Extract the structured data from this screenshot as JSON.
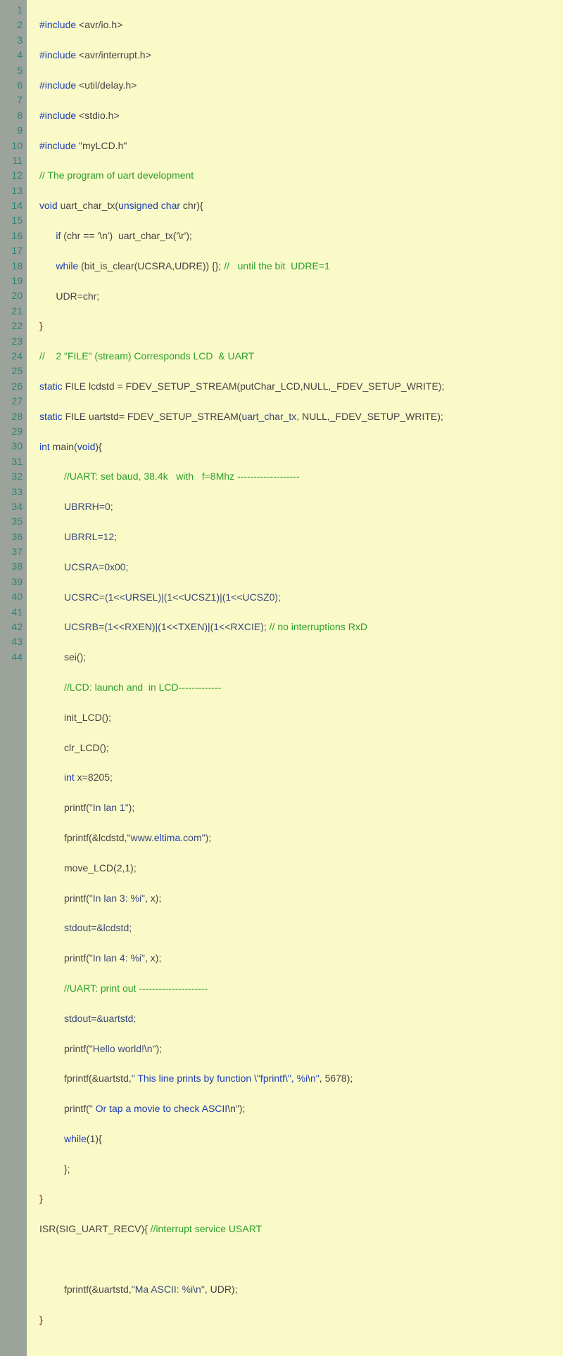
{
  "lineCount": 44,
  "lines": {
    "l1_a": "#include",
    "l1_b": " <avr/io.h>",
    "l2_a": "#include",
    "l2_b": " <avr/interrupt.h>",
    "l3_a": "#include",
    "l3_b": " <util/delay.h>",
    "l4_a": "#include",
    "l4_b": " <stdio.h>",
    "l5_a": "#include",
    "l5_b": " \"myLCD.h\"",
    "l6": "// The program of uart development",
    "l7_a": "void",
    "l7_b": " uart_char_tx(",
    "l7_c": "unsigned char",
    "l7_d": " chr){",
    "l8_a": "      if",
    "l8_b": " (chr == ",
    "l8_c": "'\\n'",
    "l8_d": ")  uart_char_tx(",
    "l8_e": "'\\r'",
    "l8_f": ");",
    "l9_a": "      while",
    "l9_b": " (bit_is_clear(UCSRA,UDRE)) {}; ",
    "l9_c": "//   until the bit  UDRE=1",
    "l10": "      UDR=chr;",
    "l11": "}",
    "l12_a": "//    2 \"FILE\" (stream)",
    "l12_b": " Corresponds LCD  & UART",
    "l13_a": "static",
    "l13_b": " FILE lcdstd = FDEV_SETUP_STREAM(putChar_LCD,NULL,_FDEV_SETUP_WRITE);",
    "l14_a": "static",
    "l14_b": " FILE uartstd= FDEV_SETUP_STREAM(",
    "l14_c": "uart_char_tx",
    "l14_d": ", NULL,_FDEV_SETUP_WRITE);",
    "l15_a": "int",
    "l15_b": " main(",
    "l15_c": "void",
    "l15_d": "){",
    "l16": "         //UART: set baud, 38.4k   with   f=8Mhz -------------------",
    "l17": "         UBRRH=0;",
    "l18": "         UBRRL=12;",
    "l19": "         UCSRA=0x00;",
    "l20": "         UCSRC=(1<<URSEL)|(1<<UCSZ1)|(1<<UCSZ0);",
    "l21_a": "         UCSRB=(1<<RXEN)|(1<<TXEN)|(1<<RXCIE); ",
    "l21_b": "// no interruptions RxD",
    "l22": "         sei();",
    "l23": "         //LCD: launch and  in LCD-------------",
    "l24": "         init_LCD();",
    "l25": "         clr_LCD();",
    "l26_a": "         int",
    "l26_b": " x=8205;",
    "l27_a": "         printf(",
    "l27_b": "\"In lan 1\"",
    "l27_c": ");",
    "l28_a": "         fprintf(&lcdstd,",
    "l28_b": "\"www.",
    "l28_c": "eltima",
    "l28_d": ".com\"",
    "l28_e": ");",
    "l29": "         move_LCD(2,1);",
    "l30_a": "         printf(",
    "l30_b": "\"In lan 3: %i\"",
    "l30_c": ", x);",
    "l31": "         stdout=&lcdstd;",
    "l32_a": "         printf(",
    "l32_b": "\"In lan 4: %i\"",
    "l32_c": ", x);",
    "l33": "         //UART: print out ---------------------",
    "l34": "         stdout=&uartstd;",
    "l35_a": "         printf(",
    "l35_b": "\"Hello world!\\n\"",
    "l35_c": ");",
    "l36_a": "         fprintf(&uartstd,",
    "l36_b": "\" This line prints by function \\\"fprintf\\\", %i\\n\"",
    "l36_c": ", 5678);",
    "l37_a": "         printf(",
    "l37_b": "\" Or tap a movie to check ASCII",
    "l37_c": "\\n\"",
    "l37_d": ");",
    "l38_a": "         while",
    "l38_b": "(1){",
    "l39": "         };",
    "l40": "}",
    "l41_a": "ISR(SIG_UART_RECV){ ",
    "l41_b": "//interrupt service USART",
    "l42": "",
    "l43_a": "         fprintf(&uartstd,",
    "l43_b": "\"Ma ASCII: %i\\n\"",
    "l43_c": ", UDR);",
    "l44": "}"
  }
}
